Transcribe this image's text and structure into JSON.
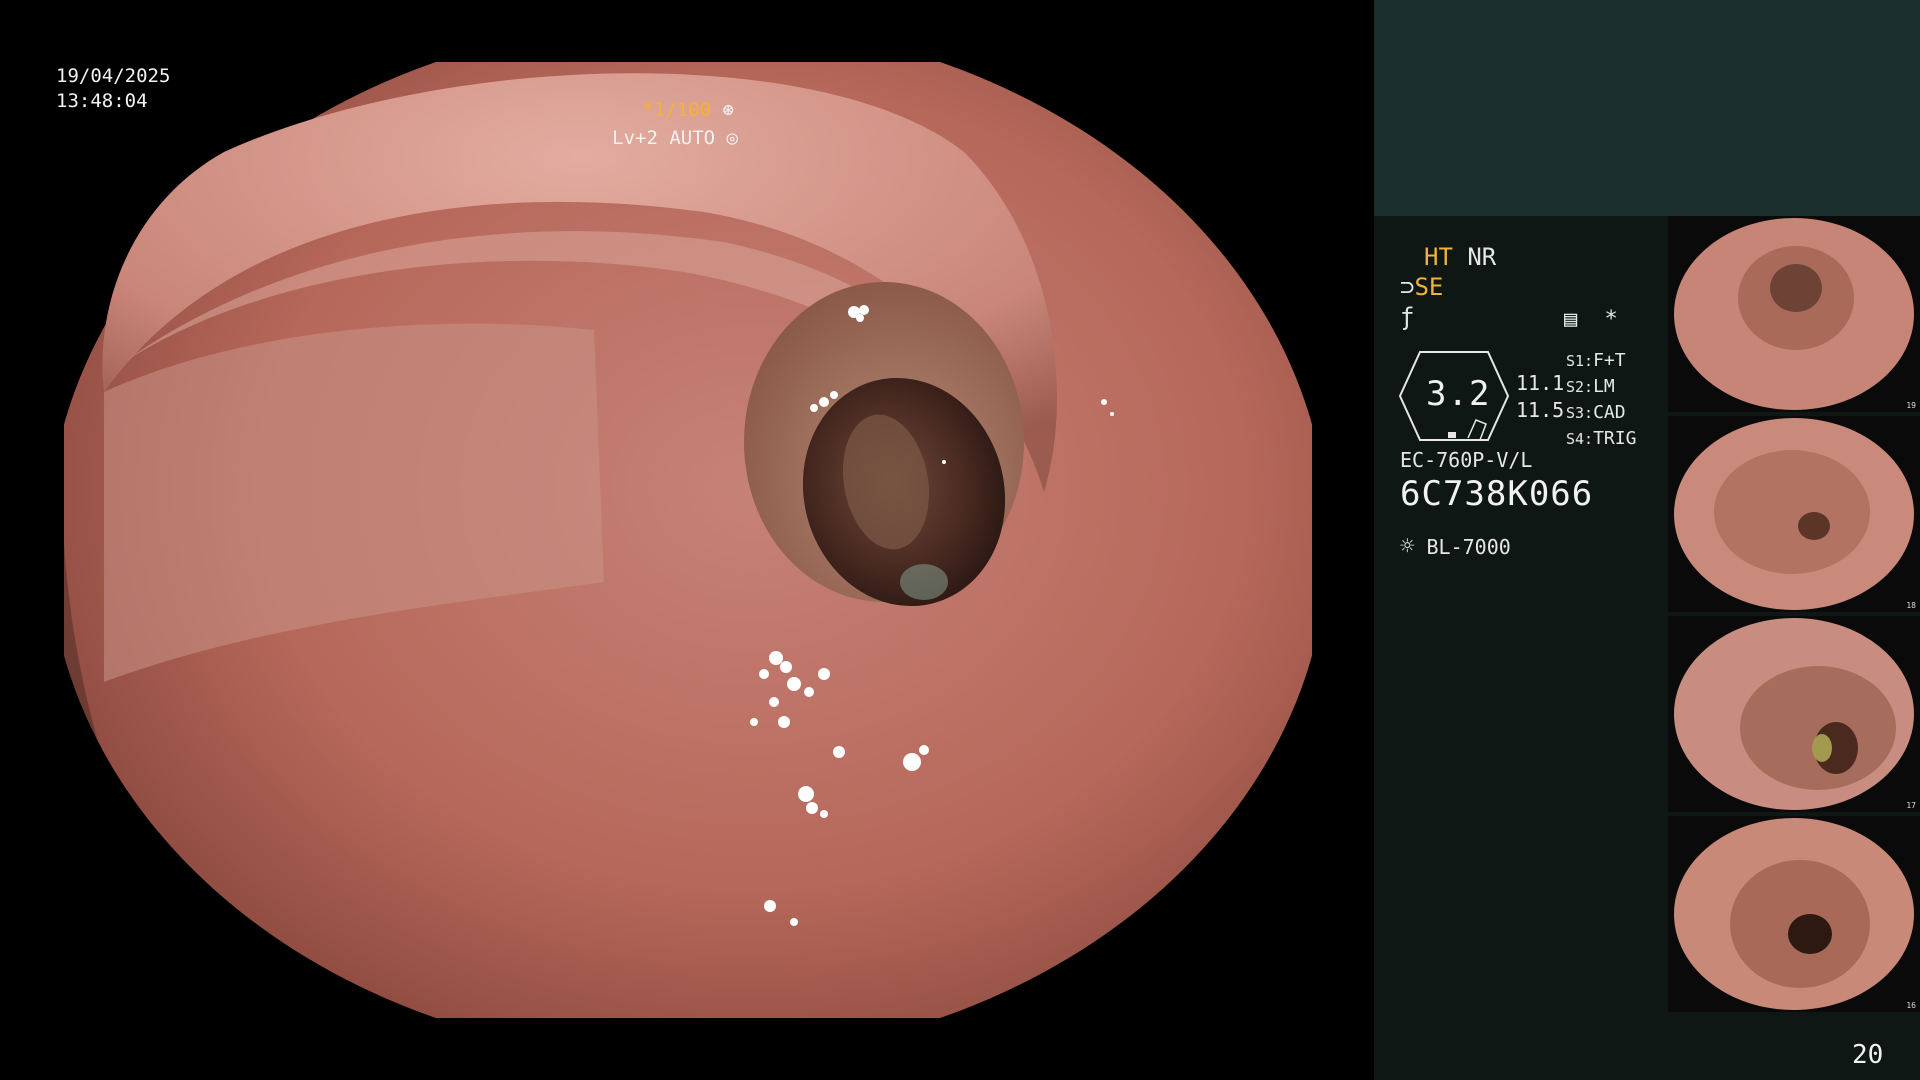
{
  "overlay": {
    "date": "19/04/2025",
    "time": "13:48:04",
    "shutter": "*1/100",
    "shutter_icon": "aperture-icon",
    "level": "Lv+2 AUTO",
    "level_icon": "iris-icon"
  },
  "panel": {
    "ht": "HT",
    "nr": "NR",
    "se": "SE",
    "gauge_value": "3.2",
    "nums": [
      "11.1",
      "11.5"
    ],
    "switches": [
      {
        "key": "S1:",
        "val": "F+T"
      },
      {
        "key": "S2:",
        "val": "LM"
      },
      {
        "key": "S3:",
        "val": "CAD"
      },
      {
        "key": "S4:",
        "val": "TRIG"
      }
    ],
    "model": "EC-760P-V/L",
    "serial": "6C738K066",
    "light_source": "BL-7000",
    "light_icon": "lamp-icon",
    "memo_icon": "memo-icon",
    "star": "*",
    "page_number": "20"
  },
  "thumbnails": [
    {
      "label": "6C738K066",
      "num": "19"
    },
    {
      "label": "6C738K066",
      "num": "18"
    },
    {
      "label": "6C738K066",
      "num": "17"
    },
    {
      "label": "6C738K066",
      "num": "16"
    }
  ],
  "colors": {
    "accent": "#f0b23a",
    "panel_bg": "#0f1715",
    "panel_top": "#1a2f2c"
  }
}
